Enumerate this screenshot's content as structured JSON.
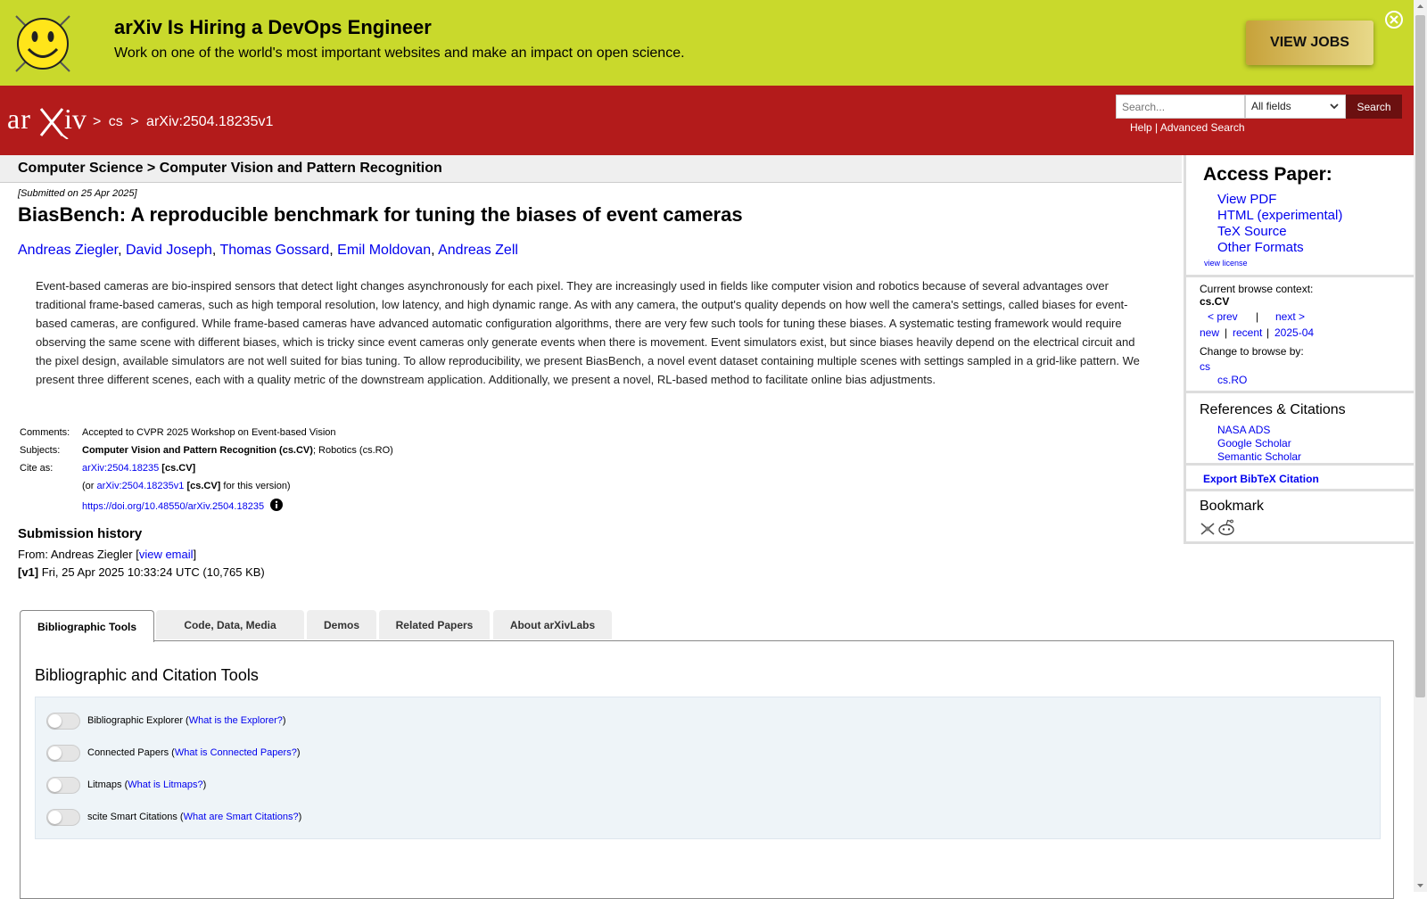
{
  "banner": {
    "title": "arXiv Is Hiring a DevOps Engineer",
    "subtitle": "Work on one of the world's most important websites and make an impact on open science.",
    "button_label": "VIEW JOBS",
    "color": "#c9d92c"
  },
  "header": {
    "color": "#b31b1b",
    "logo_text": "arXiv",
    "crumb_sep": ">",
    "crumb_cs": "cs",
    "crumb_id": "arXiv:2504.18235v1",
    "search_placeholder": "Search...",
    "search_field_value": "All fields",
    "search_button": "Search",
    "help": "Help",
    "link_sep": "|",
    "advanced": "Advanced Search"
  },
  "subheader": {
    "text": "Computer Science > Computer Vision and Pattern Recognition"
  },
  "paper": {
    "submitted": "[Submitted on 25 Apr 2025]",
    "title": "BiasBench: A reproducible benchmark for tuning the biases of event cameras",
    "authors": [
      "Andreas Ziegler",
      "David Joseph",
      "Thomas Gossard",
      "Emil Moldovan",
      "Andreas Zell"
    ],
    "author_sep": ",",
    "abstract": "Event-based cameras are bio-inspired sensors that detect light changes asynchronously for each pixel. They are increasingly used in fields like computer vision and robotics because of several advantages over traditional frame-based cameras, such as high temporal resolution, low latency, and high dynamic range. As with any camera, the output's quality depends on how well the camera's settings, called biases for event-based cameras, are configured. While frame-based cameras have advanced automatic configuration algorithms, there are very few such tools for tuning these biases. A systematic testing framework would require observing the same scene with different biases, which is tricky since event cameras only generate events when there is movement. Event simulators exist, but since biases heavily depend on the electrical circuit and the pixel design, available simulators are not well suited for bias tuning. To allow reproducibility, we present BiasBench, a novel event dataset containing multiple scenes with settings sampled in a grid-like pattern. We present three different scenes, each with a quality metric of the downstream application. Additionally, we present a novel, RL-based method to facilitate online bias adjustments."
  },
  "meta": {
    "comments_label": "Comments:",
    "comments": "Accepted to CVPR 2025 Workshop on Event-based Vision",
    "subjects_label": "Subjects:",
    "subjects_primary": "Computer Vision and Pattern Recognition (cs.CV)",
    "subjects_rest": "; Robotics (cs.RO)",
    "cite_label": "Cite as:",
    "cite_id": "arXiv:2504.18235",
    "cite_cat": "[cs.CV]",
    "cite_or": "(or",
    "cite_version": "arXiv:2504.18235v1",
    "cite_version_suffix": "for this version)",
    "doi": "https://doi.org/10.48550/arXiv.2504.18235"
  },
  "history": {
    "title": "Submission history",
    "from": "From: Andreas Ziegler [",
    "view_email": "view email",
    "close_bracket": "]",
    "v1_label": "[v1]",
    "v1_text": " Fri, 25 Apr 2025 10:33:24 UTC (10,765 KB)"
  },
  "tabs": [
    {
      "label": "Bibliographic Tools"
    },
    {
      "label": "Code, Data, Media"
    },
    {
      "label": "Demos"
    },
    {
      "label": "Related Papers"
    },
    {
      "label": "About arXivLabs"
    }
  ],
  "tools": {
    "panel_title": "Bibliographic and Citation Tools",
    "items": [
      {
        "name": "Bibliographic Explorer (",
        "link": "What is the Explorer?",
        "close": ")"
      },
      {
        "name": "Connected Papers (",
        "link": "What is Connected Papers?",
        "close": ")"
      },
      {
        "name": "Litmaps (",
        "link": "What is Litmaps?",
        "close": ")"
      },
      {
        "name": "scite Smart Citations (",
        "link": "What are Smart Citations?",
        "close": ")"
      }
    ]
  },
  "sidebar": {
    "access_title": "Access Paper:",
    "access_links": [
      "View PDF",
      "HTML (experimental)",
      "TeX Source",
      "Other Formats"
    ],
    "view_license": "view license",
    "context_label": "Current browse context:",
    "context_value": "cs.CV",
    "prev": "< prev",
    "pipe": "|",
    "next": "next >",
    "new": "new",
    "recent": "recent",
    "month": "2025-04",
    "change_label": "Change to browse by:",
    "browse_cs": "cs",
    "browse_ro": "cs.RO",
    "refs_title": "References & Citations",
    "refs": [
      "NASA ADS",
      "Google Scholar",
      "Semantic Scholar"
    ],
    "export_bibtex": "Export BibTeX Citation",
    "bookmark_title": "Bookmark"
  }
}
